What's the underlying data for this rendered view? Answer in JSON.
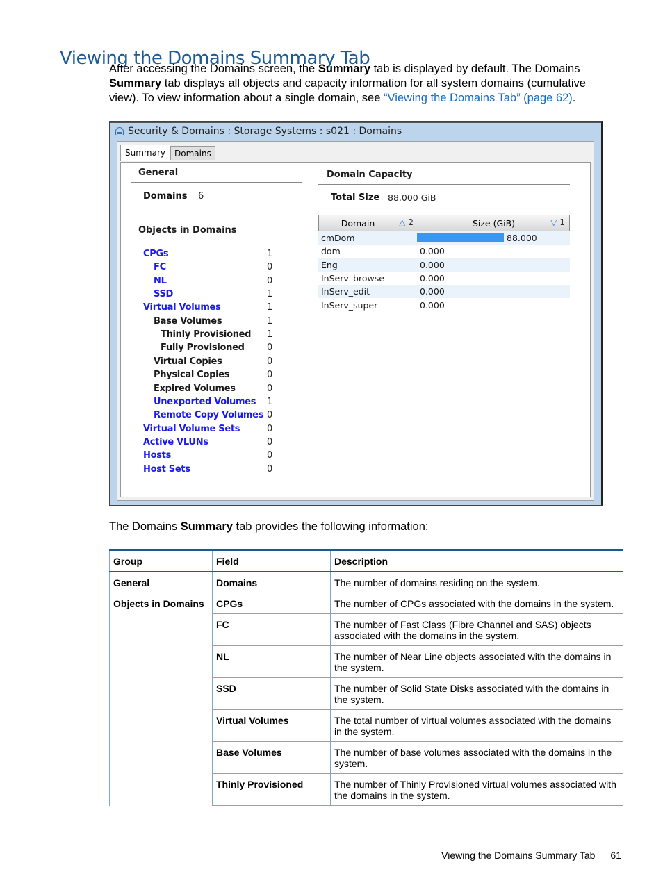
{
  "page": {
    "heading": "Viewing the Domains Summary Tab",
    "intro": {
      "p1": "After accessing the Domains screen, the ",
      "b1": "Summary",
      "p2": " tab is displayed by default. The Domains ",
      "b2": "Summary",
      "p3": " tab displays all objects and capacity information for all system domains (cumulative view). To view information about a single domain, see ",
      "link": "“Viewing the Domains Tab” (page 62)",
      "p4": "."
    },
    "mid": {
      "p1": "The Domains ",
      "b1": "Summary",
      "p2": " tab provides the following information:"
    },
    "footer": {
      "title": "Viewing the Domains Summary Tab",
      "page_number": "61"
    }
  },
  "window": {
    "title": "Security & Domains : Storage Systems : s021 : Domains",
    "tabs": [
      {
        "label": "Summary",
        "active": true
      },
      {
        "label": "Domains",
        "active": false
      }
    ],
    "general": {
      "title": "General",
      "domains_label": "Domains",
      "domains_value": "6"
    },
    "objects": {
      "title": "Objects in Domains",
      "items": [
        {
          "label": "CPGs",
          "count": "1",
          "indent": 0,
          "link": true
        },
        {
          "label": "FC",
          "count": "0",
          "indent": 1,
          "link": true
        },
        {
          "label": "NL",
          "count": "0",
          "indent": 1,
          "link": true
        },
        {
          "label": "SSD",
          "count": "1",
          "indent": 1,
          "link": true
        },
        {
          "label": "Virtual Volumes",
          "count": "1",
          "indent": 0,
          "link": true
        },
        {
          "label": "Base Volumes",
          "count": "1",
          "indent": 1,
          "link": false
        },
        {
          "label": "Thinly Provisioned",
          "count": "1",
          "indent": 2,
          "link": false
        },
        {
          "label": "Fully Provisioned",
          "count": "0",
          "indent": 2,
          "link": false
        },
        {
          "label": "Virtual Copies",
          "count": "0",
          "indent": 1,
          "link": false
        },
        {
          "label": "Physical Copies",
          "count": "0",
          "indent": 1,
          "link": false
        },
        {
          "label": "Expired Volumes",
          "count": "0",
          "indent": 1,
          "link": false
        },
        {
          "label": "Unexported Volumes",
          "count": "1",
          "indent": 1,
          "link": true
        },
        {
          "label": "Remote Copy Volumes",
          "count": "0",
          "indent": 1,
          "link": true
        },
        {
          "label": "Virtual Volume Sets",
          "count": "0",
          "indent": 0,
          "link": true
        },
        {
          "label": "Active VLUNs",
          "count": "0",
          "indent": 0,
          "link": true
        },
        {
          "label": "Hosts",
          "count": "0",
          "indent": 0,
          "link": true
        },
        {
          "label": "Host Sets",
          "count": "0",
          "indent": 0,
          "link": true
        }
      ]
    },
    "capacity": {
      "title": "Domain Capacity",
      "total_label": "Total Size",
      "total_value": "88.000 GiB",
      "columns": [
        {
          "label": "Domain",
          "sort_dir": "up",
          "sort_order": "2"
        },
        {
          "label": "Size (GiB)",
          "sort_dir": "down",
          "sort_order": "1"
        }
      ],
      "bar_color": "#3a96ee",
      "rows": [
        {
          "domain": "cmDom",
          "size": "88.000",
          "fraction": 1.0
        },
        {
          "domain": "dom",
          "size": "0.000",
          "fraction": 0
        },
        {
          "domain": "Eng",
          "size": "0.000",
          "fraction": 0
        },
        {
          "domain": "InServ_browse",
          "size": "0.000",
          "fraction": 0
        },
        {
          "domain": "InServ_edit",
          "size": "0.000",
          "fraction": 0
        },
        {
          "domain": "InServ_super",
          "size": "0.000",
          "fraction": 0
        }
      ]
    }
  },
  "table": {
    "headers": [
      "Group",
      "Field",
      "Description"
    ],
    "rows": [
      {
        "group": "General",
        "field": "Domains",
        "description": "The number of domains residing on the system."
      },
      {
        "group": "Objects in Domains",
        "field": "CPGs",
        "description": "The number of CPGs associated with the domains in the system."
      },
      {
        "group": "",
        "field": "FC",
        "description": "The number of Fast Class (Fibre Channel and SAS) objects associated with the domains in the system."
      },
      {
        "group": "",
        "field": "NL",
        "description": "The number of Near Line objects associated with the domains in the system."
      },
      {
        "group": "",
        "field": "SSD",
        "description": "The number of Solid State Disks associated with the domains in the system."
      },
      {
        "group": "",
        "field": "Virtual Volumes",
        "description": "The total number of virtual volumes associated with the domains in the system."
      },
      {
        "group": "",
        "field": "Base Volumes",
        "description": "The number of base volumes associated with the domains in the system."
      },
      {
        "group": "",
        "field": "Thinly Provisioned",
        "description": "The number of Thinly Provisioned virtual volumes associated with the domains in the system."
      }
    ]
  }
}
